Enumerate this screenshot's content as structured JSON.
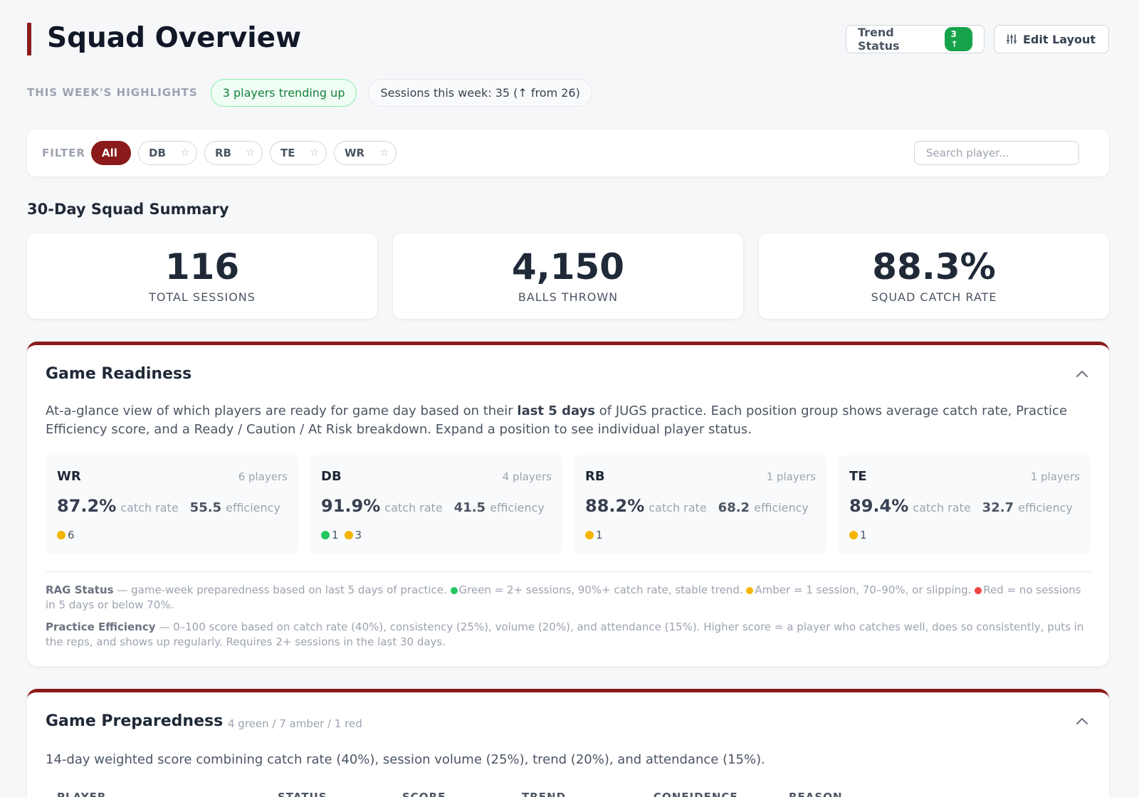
{
  "header": {
    "title": "Squad Overview",
    "trend_status_label": "Trend Status",
    "trend_badge": "3 ↑",
    "edit_layout_label": "Edit Layout"
  },
  "highlights": {
    "label": "THIS WEEK'S HIGHLIGHTS",
    "pill_trending": "3 players trending up",
    "pill_sessions": "Sessions this week: 35 (↑ from 26)"
  },
  "filter": {
    "label": "FILTER",
    "chips": [
      "All",
      "DB",
      "RB",
      "TE",
      "WR"
    ],
    "active": "All",
    "search_placeholder": "Search player...",
    "star": "☆"
  },
  "summary": {
    "title": "30-Day Squad Summary",
    "stats": [
      {
        "value": "116",
        "label": "TOTAL SESSIONS"
      },
      {
        "value": "4,150",
        "label": "BALLS THROWN"
      },
      {
        "value": "88.3%",
        "label": "SQUAD CATCH RATE"
      }
    ]
  },
  "game_readiness": {
    "title": "Game Readiness",
    "desc_pre": "At-a-glance view of which players are ready for game day based on their ",
    "desc_bold": "last 5 days",
    "desc_post": " of JUGS practice. Each position group shows average catch rate, Practice Efficiency score, and a Ready / Caution / At Risk breakdown. Expand a position to see individual player status.",
    "catch_unit": "catch rate",
    "eff_unit": "efficiency",
    "positions": [
      {
        "name": "WR",
        "count": "6 players",
        "rate": "87.2%",
        "eff": "55.5",
        "green": "",
        "amber": "6"
      },
      {
        "name": "DB",
        "count": "4 players",
        "rate": "91.9%",
        "eff": "41.5",
        "green": "1",
        "amber": "3"
      },
      {
        "name": "RB",
        "count": "1 players",
        "rate": "88.2%",
        "eff": "68.2",
        "green": "",
        "amber": "1"
      },
      {
        "name": "TE",
        "count": "1 players",
        "rate": "89.4%",
        "eff": "32.7",
        "green": "",
        "amber": "1"
      }
    ],
    "rag_title": "RAG Status",
    "rag_text_1": " — game-week preparedness based on last 5 days of practice. ",
    "rag_green": "Green = 2+ sessions, 90%+ catch rate, stable trend. ",
    "rag_amber": "Amber = 1 session, 70–90%, or slipping. ",
    "rag_red": "Red = no sessions in 5 days or below 70%.",
    "eff_title": "Practice Efficiency",
    "eff_text": " — 0–100 score based on catch rate (40%), consistency (25%), volume (20%), and attendance (15%). Higher score = a player who catches well, does so consistently, puts in the reps, and shows up regularly. Requires 2+ sessions in the last 30 days."
  },
  "game_preparedness": {
    "title": "Game Preparedness",
    "summary": "4 green / 7 amber / 1 red",
    "desc": "14-day weighted score combining catch rate (40%), session volume (25%), trend (20%), and attendance (15%).",
    "columns": [
      "PLAYER",
      "STATUS",
      "SCORE",
      "TREND",
      "CONFIDENCE",
      "REASON"
    ]
  },
  "colors": {
    "accent": "#8b1a1a",
    "green": "#22c55e",
    "amber": "#f5b400",
    "red": "#ef4444"
  }
}
